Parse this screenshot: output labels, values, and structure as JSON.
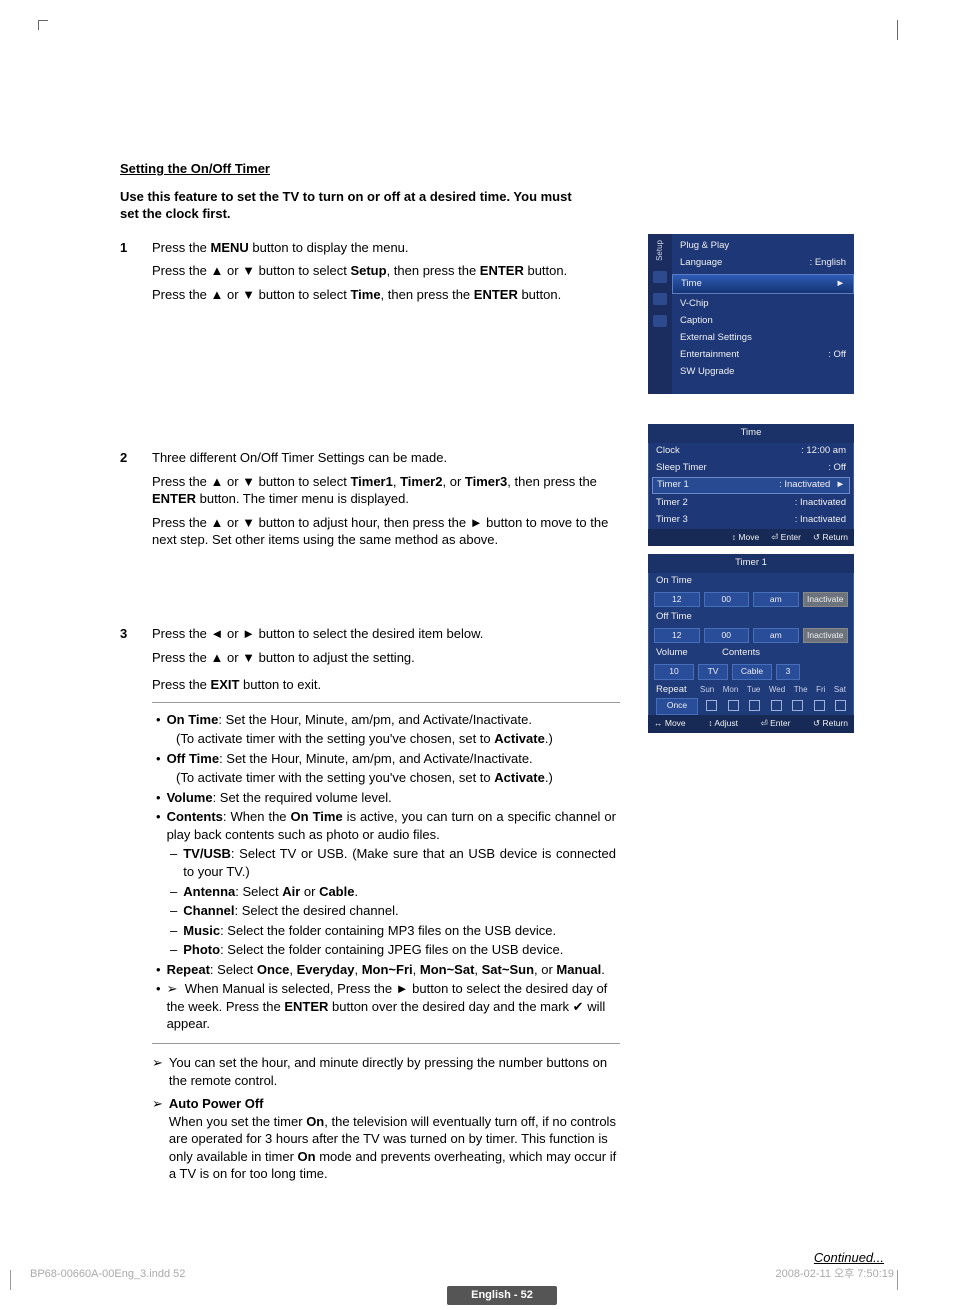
{
  "section_title": "Setting the On/Off Timer",
  "intro": "Use this feature to set the TV to turn on or off at a desired time. You must set the clock first.",
  "steps": {
    "s1": {
      "num": "1",
      "l1a": "Press the ",
      "l1_menu": "MENU",
      "l1b": " button to display the menu.",
      "l2a": "Press the ▲ or ▼ button to select ",
      "l2_setup": "Setup",
      "l2b": ", then press the ",
      "l2_enter": "ENTER",
      "l2c": " button.",
      "l3a": "Press the ▲ or ▼ button to select ",
      "l3_time": "Time",
      "l3b": ", then press the ",
      "l3_enter": "ENTER",
      "l3c": " button."
    },
    "s2": {
      "num": "2",
      "l1": "Three different On/Off Timer Settings can be made.",
      "l2a": "Press the ▲ or ▼ button to select ",
      "l2_t1": "Timer1",
      "l2_c1": ", ",
      "l2_t2": "Timer2",
      "l2_c2": ", or ",
      "l2_t3": "Timer3",
      "l2b": ", then press the ",
      "l2_enter": "ENTER",
      "l2c": " button. The timer menu is displayed.",
      "l3": "Press the ▲ or ▼ button to adjust hour, then press the ► button to move to the next step. Set other items using the same method as above."
    },
    "s3": {
      "num": "3",
      "l1": "Press the ◄ or ► button to select the desired item below.",
      "l2": "Press the ▲ or ▼ button to adjust the setting.",
      "l3a": "Press the ",
      "l3_exit": "EXIT",
      "l3b": " button to exit."
    }
  },
  "bullets": {
    "b1_k": "On Time",
    "b1_v": ": Set the Hour, Minute, am/pm, and Activate/Inactivate.",
    "b1_sub_a": "(To activate timer with the setting you've chosen, set to ",
    "b1_sub_act": "Activate",
    "b1_sub_b": ".)",
    "b2_k": "Off Time",
    "b2_v": ": Set the Hour, Minute, am/pm, and Activate/Inactivate.",
    "b2_sub_a": "(To activate timer with the setting you've chosen, set to ",
    "b2_sub_act": "Activate",
    "b2_sub_b": ".)",
    "b3_k": "Volume",
    "b3_v": ": Set the required volume level.",
    "b4_k": "Contents",
    "b4_v_a": ": When the ",
    "b4_v_on": "On Time",
    "b4_v_b": " is active, you can turn on a specific channel or play back contents such as photo or audio files.",
    "b4a_k": "TV/USB",
    "b4a_v": ": Select TV or USB. (Make sure that an USB device is connected to your TV.)",
    "b4b_k": "Antenna",
    "b4b_v_a": ": Select ",
    "b4b_air": "Air",
    "b4b_or": " or ",
    "b4b_cable": "Cable",
    "b4b_dot": ".",
    "b4c_k": "Channel",
    "b4c_v": ": Select the desired channel.",
    "b4d_k": "Music",
    "b4d_v": ": Select the folder containing MP3 files on the USB device.",
    "b4e_k": "Photo",
    "b4e_v": ": Select the folder containing JPEG files on the USB device.",
    "b5_k": "Repeat",
    "b5_v_a": ": Select ",
    "b5_once": "Once",
    "b5_c1": ", ",
    "b5_every": "Everyday",
    "b5_c2": ", ",
    "b5_mf": "Mon~Fri",
    "b5_c3": ", ",
    "b5_ms": "Mon~Sat",
    "b5_c4": ", ",
    "b5_ss": "Sat~Sun",
    "b5_c5": ", or ",
    "b5_man": "Manual",
    "b5_dot": ".",
    "b5_note_a": "When Manual is selected, Press the ► button to select the desired day of the week. Press the ",
    "b5_note_enter": "ENTER",
    "b5_note_b": " button over the desired day and the mark ",
    "b5_note_checkicon": "✔",
    "b5_note_c": " will appear."
  },
  "notes": {
    "n1": "You can set the hour, and minute directly by pressing the number buttons on the remote control.",
    "n2_title": "Auto Power Off",
    "n2_a": "When you set the timer ",
    "n2_on": "On",
    "n2_b": ", the television will eventually turn off, if no controls are operated for 3 hours after the TV was turned on by timer. This function is only available in timer ",
    "n2_on2": "On",
    "n2_c": " mode and prevents overheating, which may occur if a TV is on for too long time."
  },
  "continued": "Continued...",
  "page_badge": "English - 52",
  "footer_left": "BP68-00660A-00Eng_3.indd   52",
  "footer_right": "2008-02-11   오후 7:50:19",
  "osd1": {
    "tab": "Setup",
    "items": [
      {
        "k": "Plug & Play",
        "v": ""
      },
      {
        "k": "Language",
        "v": ": English"
      }
    ],
    "hl": "Time",
    "arrow": "►",
    "items2": [
      {
        "k": "V-Chip",
        "v": ""
      },
      {
        "k": "Caption",
        "v": ""
      },
      {
        "k": "External Settings",
        "v": ""
      },
      {
        "k": "Entertainment",
        "v": ": Off"
      },
      {
        "k": "SW Upgrade",
        "v": ""
      }
    ]
  },
  "osd2": {
    "title": "Time",
    "rows": [
      {
        "k": "Clock",
        "v": ": 12:00 am"
      },
      {
        "k": "Sleep Timer",
        "v": ": Off"
      }
    ],
    "hl": {
      "k": "Timer 1",
      "v": ": Inactivated",
      "arr": "►"
    },
    "rows2": [
      {
        "k": "Timer 2",
        "v": ": Inactivated"
      },
      {
        "k": "Timer 3",
        "v": ": Inactivated"
      }
    ],
    "foot": {
      "move": "↕ Move",
      "enter": "⏎ Enter",
      "ret": "↺ Return"
    }
  },
  "osd3": {
    "title": "Timer 1",
    "on_time": "On Time",
    "off_time": "Off Time",
    "row_time": {
      "h": "12",
      "m": "00",
      "ap": "am",
      "state": "Inactivate"
    },
    "volume": "Volume",
    "contents": "Contents",
    "vol_val": "10",
    "tv": "TV",
    "cable": "Cable",
    "ch": "3",
    "repeat": "Repeat",
    "days": [
      "Sun",
      "Mon",
      "Tue",
      "Wed",
      "The",
      "Fri",
      "Sat"
    ],
    "once": "Once",
    "foot": {
      "move": "↔ Move",
      "adjust": "↕ Adjust",
      "enter": "⏎ Enter",
      "ret": "↺ Return"
    }
  }
}
